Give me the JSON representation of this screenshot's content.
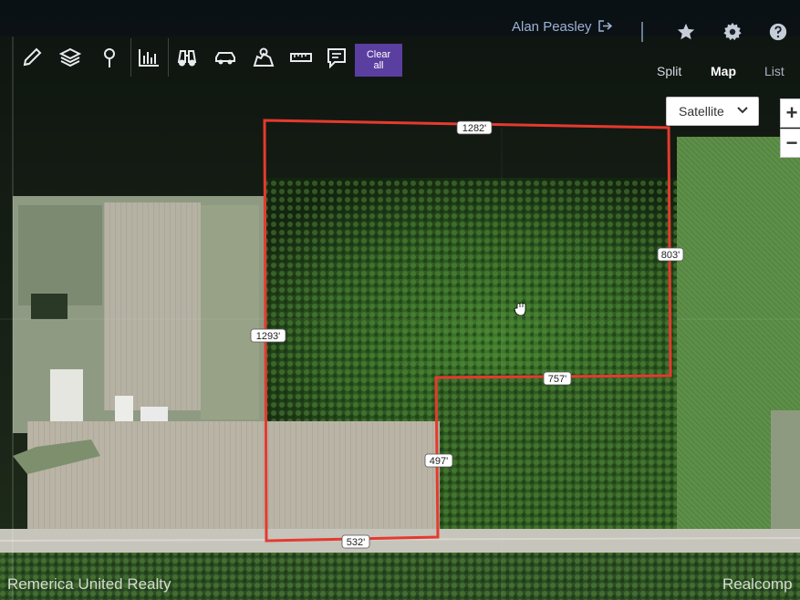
{
  "header": {
    "user_name": "Alan Peasley"
  },
  "toolbar": {
    "tools": [
      "pencil-icon",
      "layers-icon",
      "map-pin-icon",
      "bar-chart-icon",
      "binoculars-icon",
      "car-icon",
      "map-area-icon",
      "ruler-icon",
      "comment-icon"
    ],
    "clear_label": "Clear all"
  },
  "view_tabs": {
    "split": "Split",
    "map": "Map",
    "list": "List"
  },
  "map_controls": {
    "map_type": "Satellite",
    "zoom_in": "+",
    "zoom_out": "−"
  },
  "parcel": {
    "boundary_color": "#e53a2f",
    "dimensions": {
      "top": "1282'",
      "right": "803'",
      "left": "1293'",
      "inner_horizontal": "757'",
      "inner_vertical": "497'",
      "bottom": "532'"
    }
  },
  "footer": {
    "watermark_left": "Remerica United Realty",
    "watermark_right": "Realcomp"
  },
  "colors": {
    "accent": "#5a3fa0",
    "link": "#9db2d4"
  }
}
